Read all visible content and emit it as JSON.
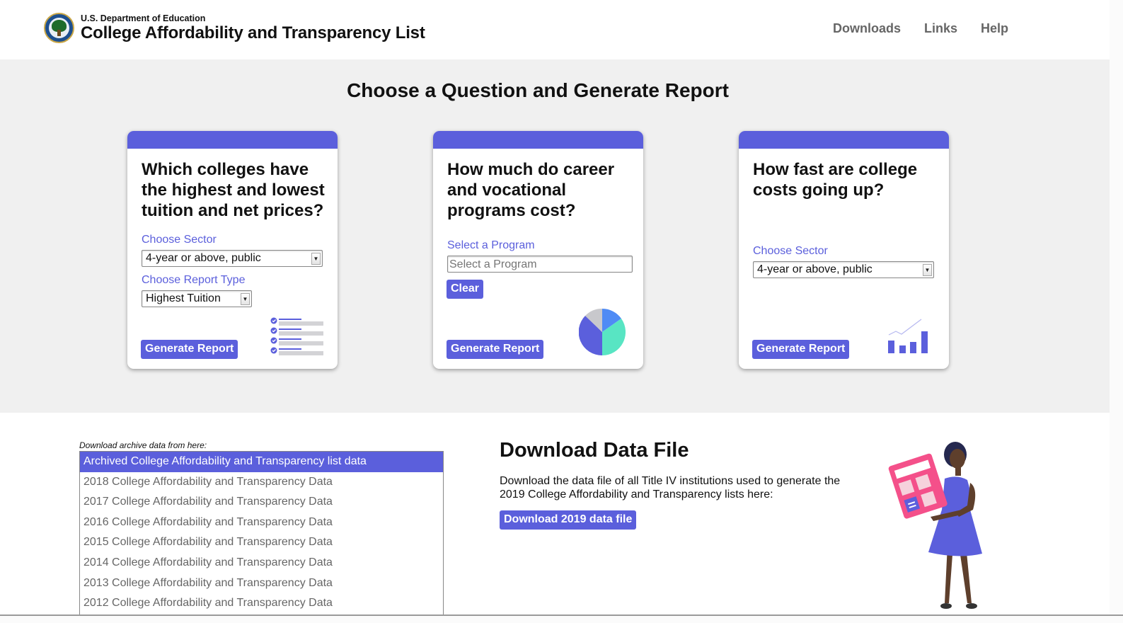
{
  "header": {
    "department": "U.S. Department of Education",
    "title": "College Affordability and Transparency List",
    "nav": [
      "Downloads",
      "Links",
      "Help"
    ]
  },
  "main": {
    "title": "Choose a Question and Generate Report",
    "cards": [
      {
        "question": "Which colleges have the highest and lowest tuition and net prices?",
        "sector_label": "Choose Sector",
        "sector_value": "4-year or above, public",
        "report_type_label": "Choose Report Type",
        "report_type_value": "Highest Tuition",
        "generate_label": "Generate Report",
        "illustration": "checklist-icon"
      },
      {
        "question": "How much do career and vocational programs cost?",
        "program_label": "Select a Program",
        "program_placeholder": "Select a Program",
        "program_value": "",
        "clear_label": "Clear",
        "generate_label": "Generate Report",
        "illustration": "pie-chart-icon"
      },
      {
        "question": "How fast are college costs going up?",
        "sector_label": "Choose Sector",
        "sector_value": "4-year or above, public",
        "generate_label": "Generate Report",
        "illustration": "bar-chart-icon"
      }
    ]
  },
  "archive": {
    "caption": "Download archive data from here:",
    "options": [
      "Archived College Affordability and Transparency list data",
      "2018 College Affordability and Transparency Data",
      "2017 College Affordability and Transparency Data",
      "2016 College Affordability and Transparency Data",
      "2015 College Affordability and Transparency Data",
      "2014 College Affordability and Transparency Data",
      "2013 College Affordability and Transparency Data",
      "2012 College Affordability and Transparency Data"
    ],
    "selected_index": 0
  },
  "download": {
    "title": "Download Data File",
    "text": "Download the data file of all Title IV institutions used to generate the 2019 College Affordability and Transparency lists here:",
    "button_label": "Download 2019 data file",
    "illustration": "woman-with-calculator-illustration"
  },
  "colors": {
    "accent": "#5b5fdc",
    "band_background": "#f0f0f0",
    "nav_text": "#666666",
    "pie_gray": "#c8c8cc",
    "pie_blue": "#4f8bf5",
    "pie_teal": "#58e5c3",
    "calculator_pink": "#f4508a"
  }
}
